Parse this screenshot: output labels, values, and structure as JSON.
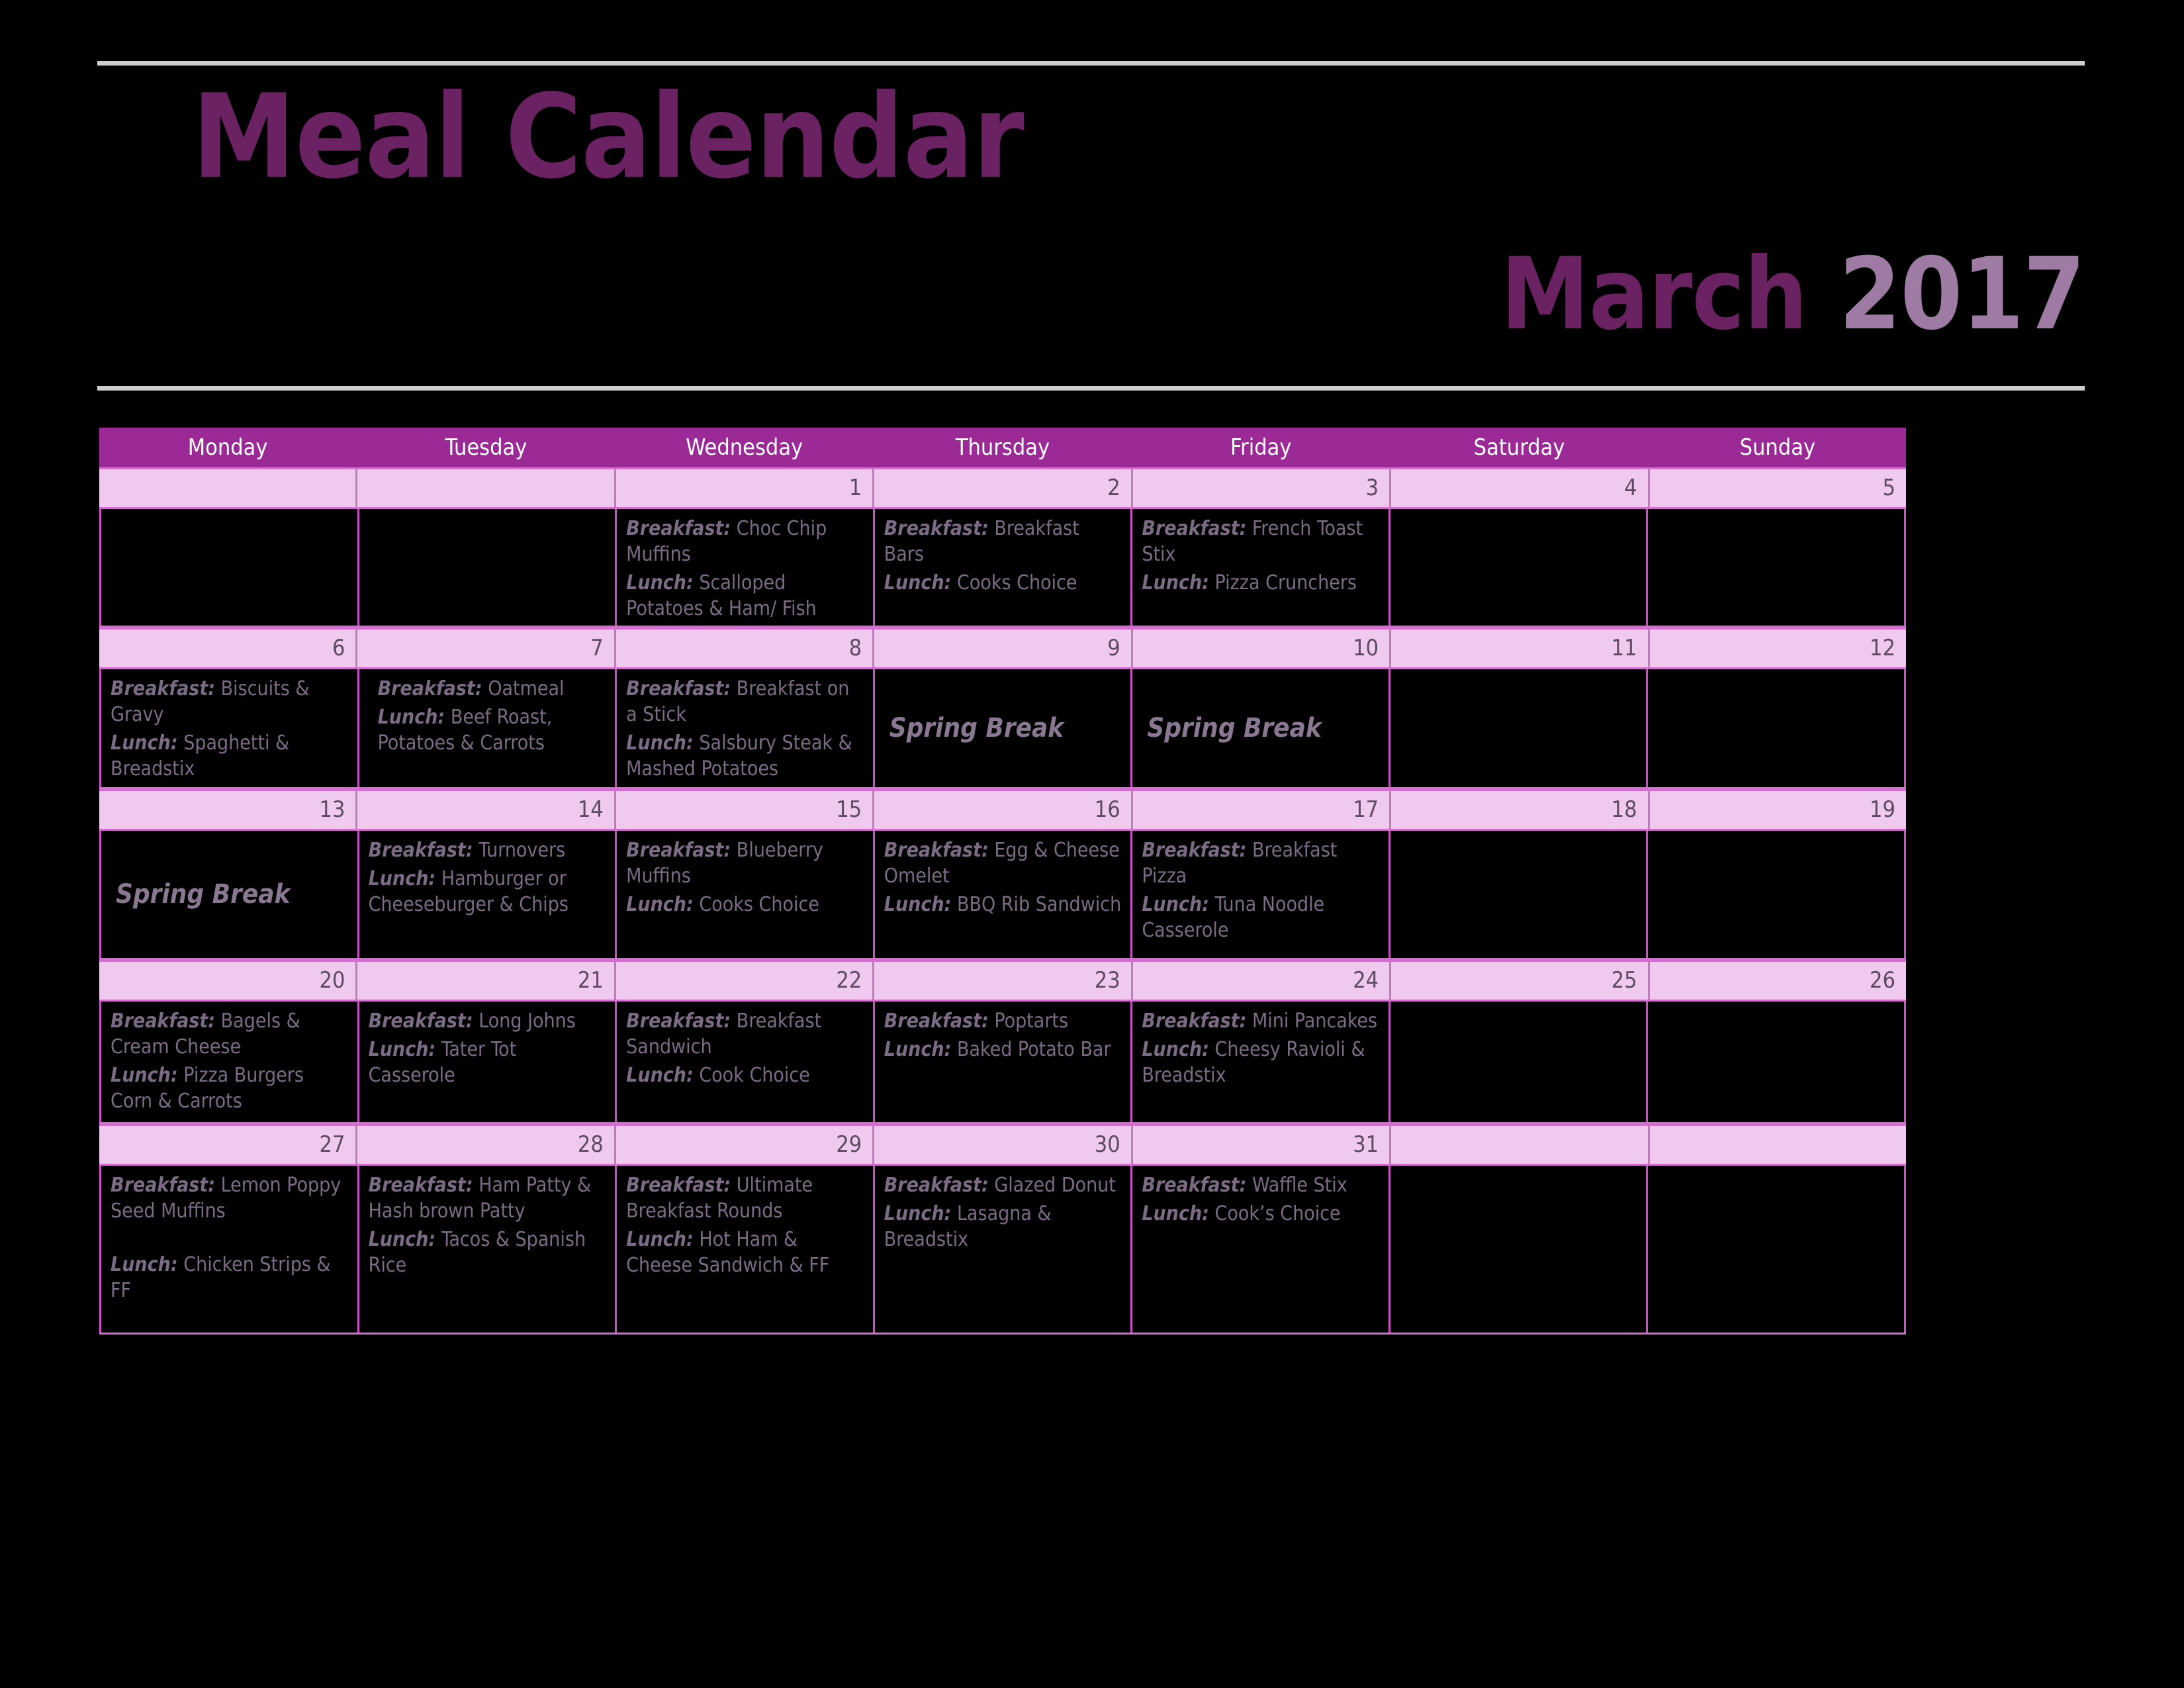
{
  "header": {
    "title": "Meal Calendar",
    "month": "March",
    "year": "2017"
  },
  "colors": {
    "background": "#000000",
    "title_purple": "#6b2262",
    "year_mauve": "#9e7ba3",
    "dow_header": "#9c2a96",
    "date_strip": "#f0c9ef",
    "grid_line": "#cb4fc6",
    "body_text": "#7b6b85",
    "rule_gray": "#cdcdcd"
  },
  "weekdays": [
    "Monday",
    "Tuesday",
    "Wednesday",
    "Thursday",
    "Friday",
    "Saturday",
    "Sunday"
  ],
  "weeks": [
    {
      "dates": [
        "",
        "",
        "1",
        "2",
        "3",
        "4",
        "5"
      ],
      "cells": [
        {
          "type": "empty"
        },
        {
          "type": "empty"
        },
        {
          "type": "meals",
          "breakfast": "Choc Chip Muffins",
          "lunch": "Scalloped Potatoes & Ham/ Fish Shapes & FF"
        },
        {
          "type": "meals",
          "breakfast": "Breakfast Bars",
          "lunch": "Cooks Choice"
        },
        {
          "type": "meals",
          "breakfast": "French Toast Stix",
          "lunch": "Pizza Crunchers"
        },
        {
          "type": "empty"
        },
        {
          "type": "empty"
        }
      ]
    },
    {
      "dates": [
        "6",
        "7",
        "8",
        "9",
        "10",
        "11",
        "12"
      ],
      "cells": [
        {
          "type": "meals",
          "breakfast": "Biscuits & Gravy",
          "lunch": "Spaghetti & Breadstix"
        },
        {
          "type": "meals",
          "indent": true,
          "breakfast": "Oatmeal",
          "lunch": "Beef Roast, Potatoes & Carrots"
        },
        {
          "type": "meals",
          "breakfast": "Breakfast on a Stick",
          "lunch": "Salsbury Steak & Mashed Potatoes"
        },
        {
          "type": "note",
          "note": "Spring Break"
        },
        {
          "type": "note",
          "note": "Spring Break"
        },
        {
          "type": "empty"
        },
        {
          "type": "empty"
        }
      ]
    },
    {
      "dates": [
        "13",
        "14",
        "15",
        "16",
        "17",
        "18",
        "19"
      ],
      "cells": [
        {
          "type": "note",
          "note": "Spring Break"
        },
        {
          "type": "meals",
          "breakfast": "Turnovers",
          "lunch": "Hamburger or Cheeseburger & Chips"
        },
        {
          "type": "meals",
          "breakfast": "Blueberry Muffins",
          "lunch": "Cooks Choice"
        },
        {
          "type": "meals",
          "breakfast": "Egg & Cheese Omelet",
          "lunch": "BBQ Rib Sandwich"
        },
        {
          "type": "meals",
          "breakfast": "Breakfast Pizza",
          "lunch": "Tuna Noodle Casserole"
        },
        {
          "type": "empty"
        },
        {
          "type": "empty"
        }
      ]
    },
    {
      "dates": [
        "20",
        "21",
        "22",
        "23",
        "24",
        "25",
        "26"
      ],
      "cells": [
        {
          "type": "meals",
          "breakfast": "Bagels & Cream Cheese",
          "lunch": "Pizza Burgers Corn & Carrots"
        },
        {
          "type": "meals",
          "breakfast": "Long Johns",
          "lunch": "Tater Tot Casserole"
        },
        {
          "type": "meals",
          "breakfast": "Breakfast Sandwich",
          "lunch": "Cook Choice"
        },
        {
          "type": "meals",
          "breakfast": "Poptarts",
          "lunch": "Baked Potato Bar"
        },
        {
          "type": "meals",
          "breakfast": "Mini Pancakes",
          "lunch": "Cheesy Ravioli & Breadstix"
        },
        {
          "type": "empty"
        },
        {
          "type": "empty"
        }
      ]
    },
    {
      "dates": [
        "27",
        "28",
        "29",
        "30",
        "31",
        "",
        ""
      ],
      "cells": [
        {
          "type": "meals",
          "gap": true,
          "breakfast": "Lemon Poppy Seed Muffins",
          "lunch": "Chicken Strips & FF"
        },
        {
          "type": "meals",
          "breakfast": "Ham Patty & Hash brown Patty",
          "lunch": "Tacos & Spanish Rice"
        },
        {
          "type": "meals",
          "breakfast": "Ultimate Breakfast Rounds",
          "lunch": "Hot Ham & Cheese Sandwich & FF"
        },
        {
          "type": "meals",
          "breakfast": "Glazed Donut",
          "lunch": "Lasagna & Breadstix"
        },
        {
          "type": "meals",
          "breakfast": "Waffle Stix",
          "lunch": "Cook’s Choice"
        },
        {
          "type": "empty"
        },
        {
          "type": "empty"
        }
      ]
    }
  ],
  "labels": {
    "breakfast": "Breakfast:",
    "lunch": "Lunch:"
  }
}
